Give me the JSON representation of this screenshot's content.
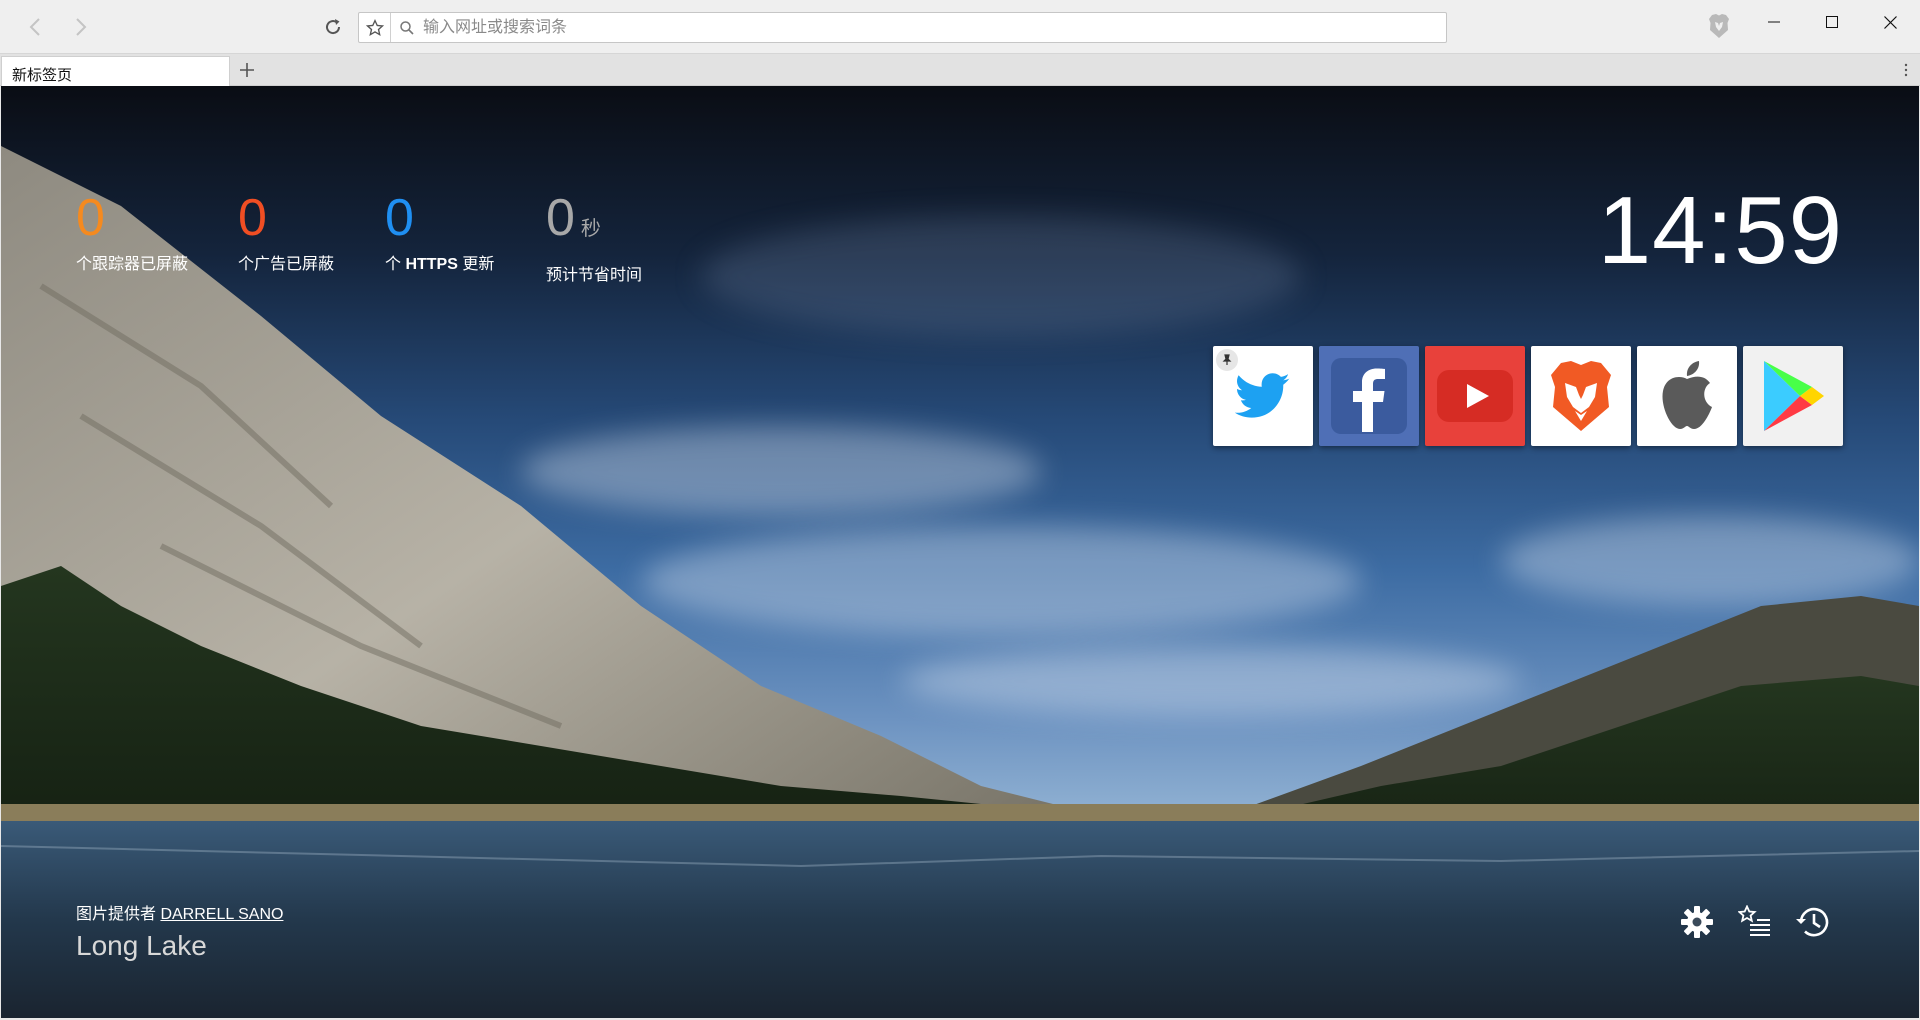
{
  "toolbar": {
    "url_placeholder": "输入网址或搜索词条",
    "back_icon": "chevron-left-icon",
    "forward_icon": "chevron-right-icon",
    "reload_icon": "reload-icon",
    "bookmark_icon": "star-icon",
    "shield_icon": "brave-lion-icon"
  },
  "tabs": [
    {
      "title": "新标签页",
      "active": true
    }
  ],
  "stats": {
    "trackers": {
      "value": "0",
      "label": "个跟踪器已屏蔽",
      "color": "#f58a1f"
    },
    "ads": {
      "value": "0",
      "label": "个广告已屏蔽",
      "color": "#f04e23"
    },
    "https": {
      "value": "0",
      "label_prefix": "个 ",
      "label_bold": "HTTPS",
      "label_suffix": " 更新",
      "color": "#1f8ff2"
    },
    "time": {
      "value": "0",
      "unit": "秒",
      "label": "预计节省时间",
      "color": "#a8a8a8"
    }
  },
  "clock": "14:59",
  "top_sites": [
    {
      "name": "twitter",
      "icon": "twitter-icon",
      "pinned": true,
      "bg": "#ffffff"
    },
    {
      "name": "facebook",
      "icon": "facebook-icon",
      "pinned": false,
      "bg": "#4f6fb6"
    },
    {
      "name": "youtube",
      "icon": "youtube-icon",
      "pinned": false,
      "bg": "#e8413b"
    },
    {
      "name": "brave",
      "icon": "brave-lion-icon",
      "pinned": false,
      "bg": "#ffffff"
    },
    {
      "name": "apple",
      "icon": "apple-icon",
      "pinned": false,
      "bg": "#ffffff"
    },
    {
      "name": "google-play",
      "icon": "google-play-icon",
      "pinned": false,
      "bg": "#f1f1f1"
    }
  ],
  "credit": {
    "prefix": "图片提供者 ",
    "author": "DARRELL SANO",
    "location": "Long Lake"
  },
  "bottom_icons": [
    "gear-icon",
    "bookmarks-list-icon",
    "history-icon"
  ]
}
